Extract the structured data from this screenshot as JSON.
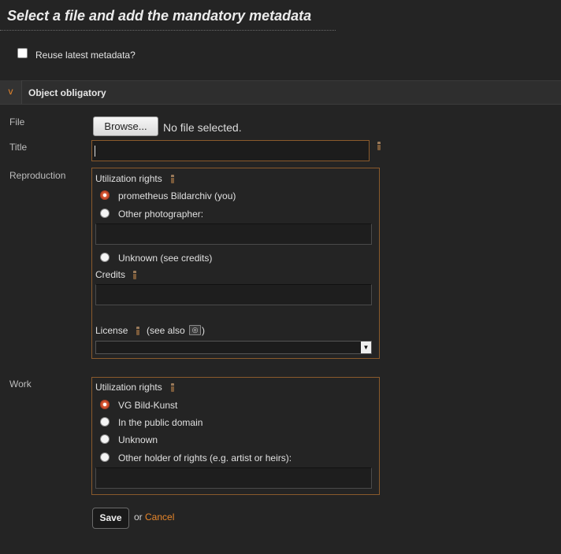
{
  "page_title": "Select a file and add the mandatory metadata",
  "reuse_label": "Reuse latest metadata?",
  "section": {
    "toggle": "v",
    "title": "Object obligatory"
  },
  "file": {
    "label": "File",
    "browse_label": "Browse...",
    "status": "No file selected."
  },
  "title_field": {
    "label": "Title",
    "value": ""
  },
  "reproduction": {
    "label": "Reproduction",
    "rights_label": "Utilization rights",
    "options": [
      {
        "label": "prometheus Bildarchiv (you)",
        "checked": true
      },
      {
        "label": "Other photographer:",
        "checked": false
      },
      {
        "label": "Unknown (see credits)",
        "checked": false
      }
    ],
    "credits_label": "Credits",
    "license_label": "License",
    "see_also_prefix": "(see also",
    "see_also_suffix": ")",
    "license_value": ""
  },
  "work": {
    "label": "Work",
    "rights_label": "Utilization rights",
    "options": [
      {
        "label": "VG Bild-Kunst",
        "checked": true
      },
      {
        "label": "In the public domain",
        "checked": false
      },
      {
        "label": "Unknown",
        "checked": false
      },
      {
        "label": "Other holder of rights (e.g. artist or heirs):",
        "checked": false
      }
    ]
  },
  "actions": {
    "save_label": "Save",
    "or_text": "or",
    "cancel_label": "Cancel"
  },
  "colors": {
    "accent": "#e8862a",
    "background": "#242424",
    "field_border": "#8a5a2c"
  }
}
